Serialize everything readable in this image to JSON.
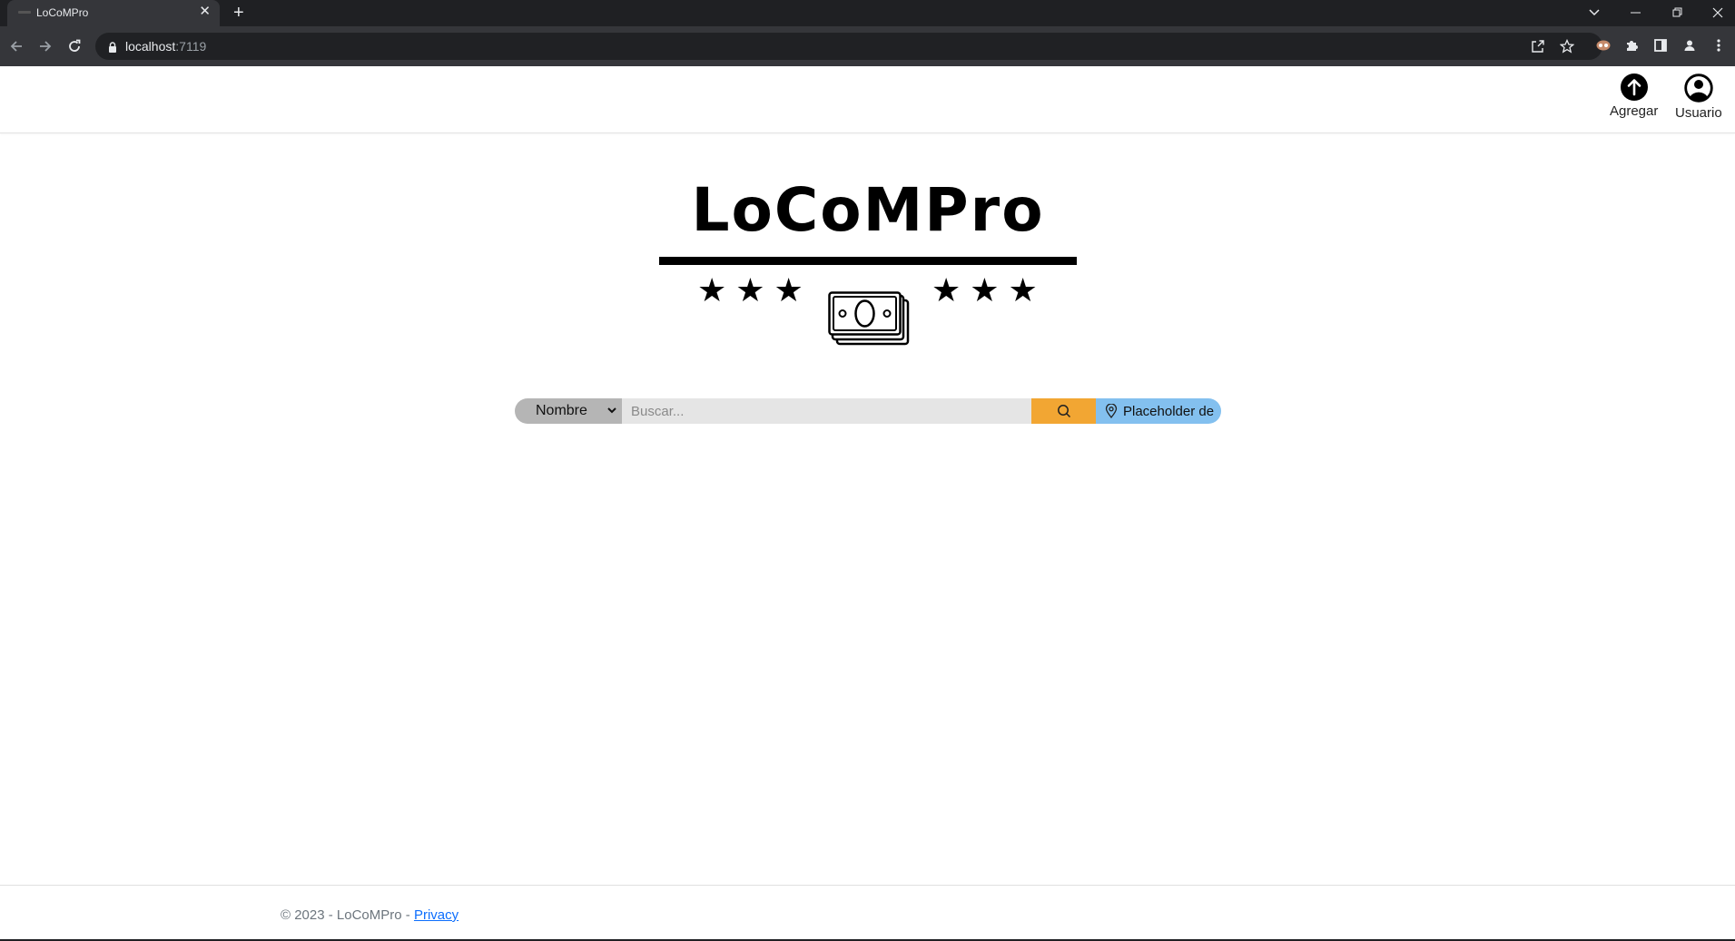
{
  "browser": {
    "tab_title": "LoCoMPro",
    "tab_close": "✕",
    "new_tab": "+",
    "url_host": "localhost",
    "url_port": ":7119",
    "icons": [
      "back-arrow-icon",
      "forward-arrow-icon",
      "reload-icon",
      "lock-icon",
      "share-icon",
      "star-icon",
      "extension-icon",
      "puzzle-icon",
      "sidebar-icon",
      "profile-icon",
      "menu-icon"
    ]
  },
  "header": {
    "add_label": "Agregar",
    "user_label": "Usuario"
  },
  "logo": {
    "title": "LoCoMPro",
    "stars_left": "★★★",
    "stars_right": "★★★"
  },
  "search": {
    "filter_value": "Nombre",
    "placeholder": "Buscar...",
    "location_label": "Placeholder de"
  },
  "colors": {
    "search_button": "#f2a633",
    "location_button": "#83c0ef",
    "filter_select": "#b5b5b5",
    "link": "#0d6efd"
  },
  "footer": {
    "copyright": "© 2023 - LoCoMPro - ",
    "privacy": "Privacy"
  }
}
